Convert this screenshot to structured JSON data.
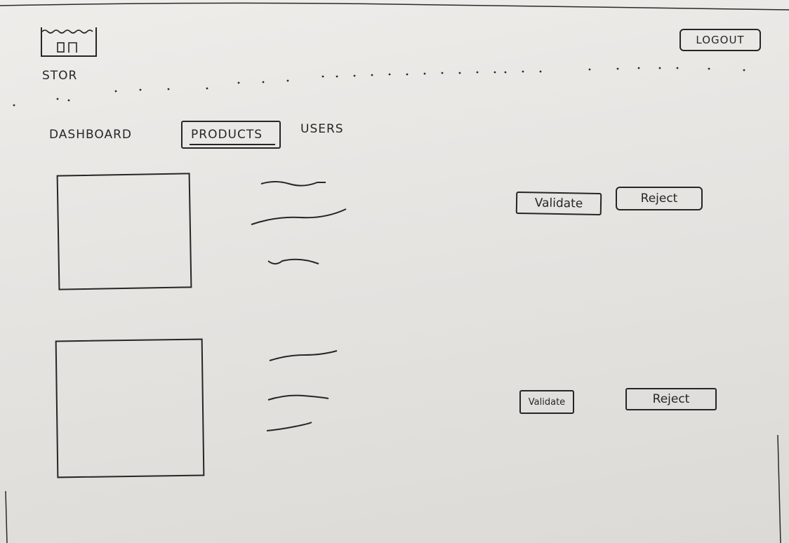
{
  "header": {
    "brand_label": "STOR",
    "logout_label": "LOGOUT"
  },
  "nav": {
    "tabs": [
      {
        "label": "DASHBOARD",
        "active": false
      },
      {
        "label": "PRODUCTS",
        "active": true
      },
      {
        "label": "USERS",
        "active": false
      }
    ]
  },
  "products": [
    {
      "validate_label": "Validate",
      "reject_label": "Reject"
    },
    {
      "validate_label": "Validate",
      "reject_label": "Reject"
    }
  ],
  "icons": {
    "logo": "store-logo-icon"
  },
  "colors": {
    "paper": "#e9e7e4",
    "ink": "#262626"
  }
}
